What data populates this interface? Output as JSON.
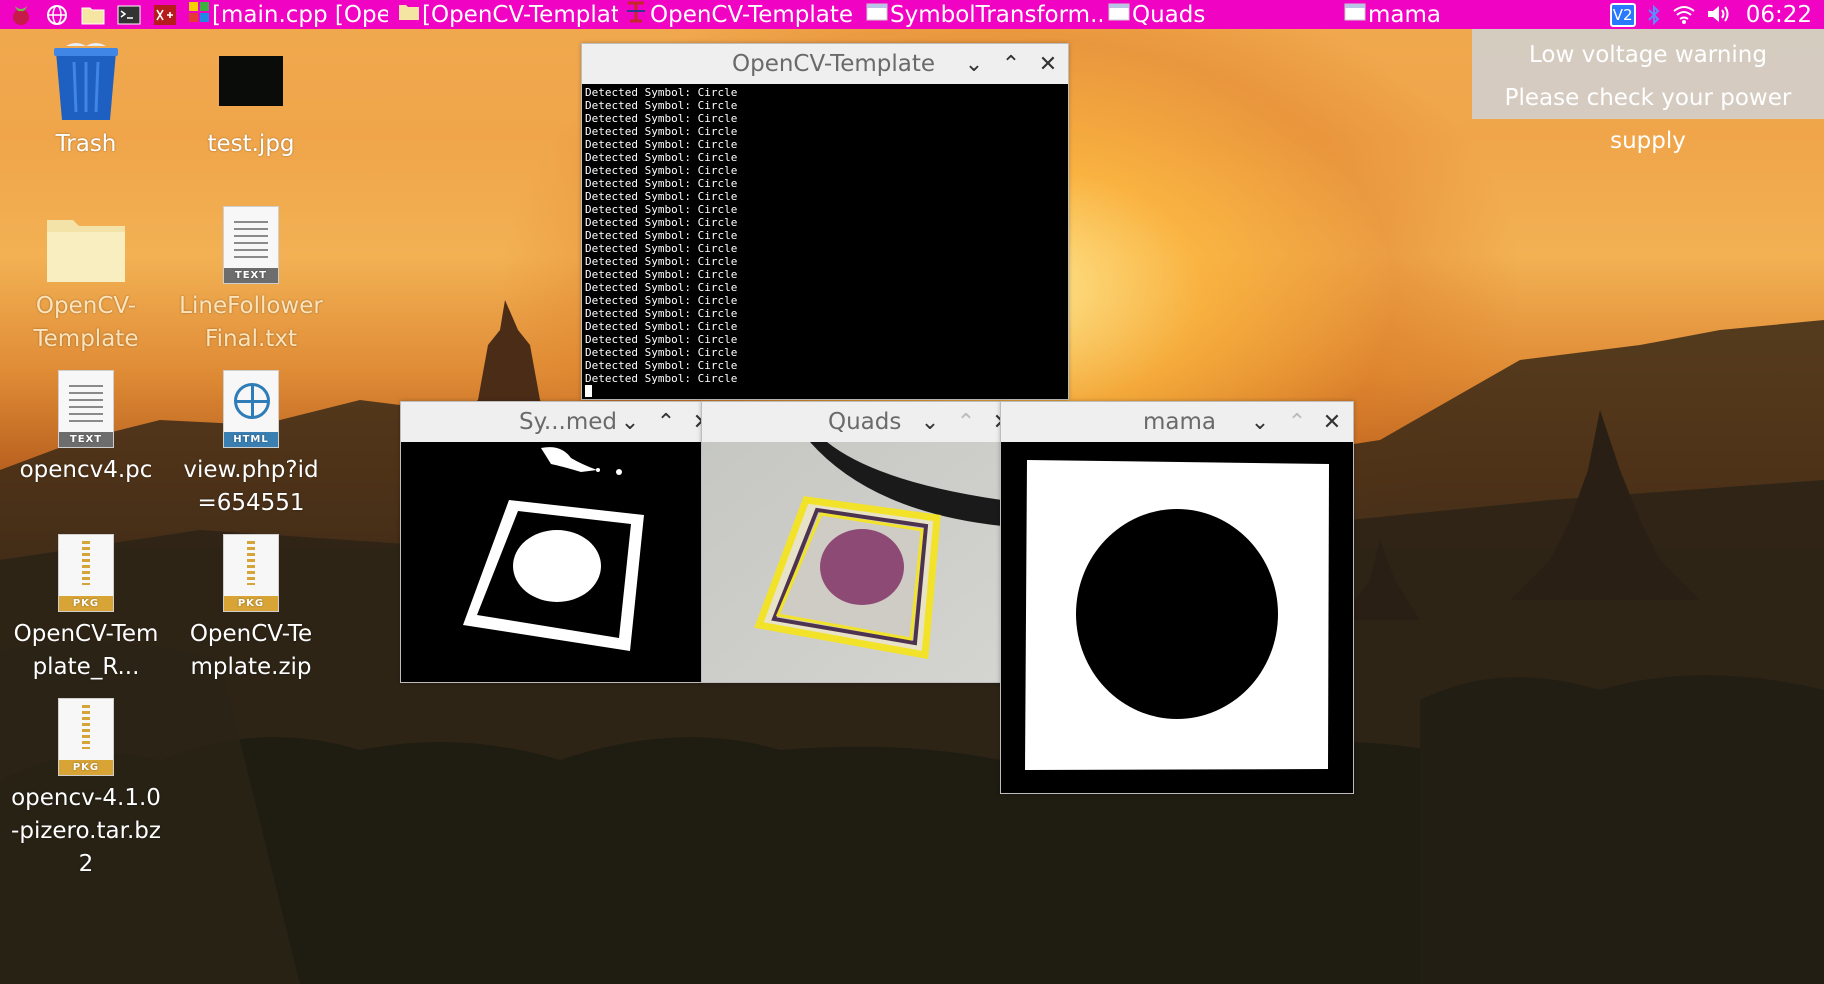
{
  "taskbar": {
    "tasks": [
      {
        "label": "[main.cpp [OpenC...",
        "icon": "geany-icon"
      },
      {
        "label": "[OpenCV-Template]",
        "icon": "folder-icon"
      },
      {
        "label": "OpenCV-Template",
        "icon": "terminal-app-icon"
      },
      {
        "label": "SymbolTransform...",
        "icon": "window-icon"
      },
      {
        "label": "Quads",
        "icon": "window-icon"
      },
      {
        "label": "mama",
        "icon": "window-icon"
      }
    ],
    "tray": {
      "vnc": "V2",
      "clock": "06:22"
    }
  },
  "desktop_icons": [
    {
      "label": "Trash",
      "icon": "trash-icon"
    },
    {
      "label": "test.jpg",
      "icon": "image-icon"
    },
    {
      "label": "OpenCV-Template",
      "icon": "folder-icon"
    },
    {
      "label": "LineFollowerFinal.txt",
      "icon": "text-file-icon",
      "badge": "TEXT"
    },
    {
      "label": "opencv4.pc",
      "icon": "text-file-icon",
      "badge": "TEXT"
    },
    {
      "label": "view.php?id=6545511...",
      "icon": "html-file-icon",
      "badge": "HTML"
    },
    {
      "label": "OpenCV-Template_R...",
      "icon": "package-icon",
      "badge": "PKG"
    },
    {
      "label": "OpenCV-Template.zip",
      "icon": "package-icon",
      "badge": "PKG"
    },
    {
      "label": "opencv-4.1.0-pizero.tar.bz2",
      "icon": "package-icon",
      "badge": "PKG"
    }
  ],
  "windows": {
    "terminal": {
      "title": "OpenCV-Template",
      "line": "Detected Symbol: Circle",
      "line_count": 23
    },
    "symbol": {
      "title": "Sy...med"
    },
    "quads": {
      "title": "Quads"
    },
    "mama": {
      "title": "mama"
    }
  },
  "notification": {
    "title": "Low voltage warning",
    "body": "Please check your power supply"
  }
}
